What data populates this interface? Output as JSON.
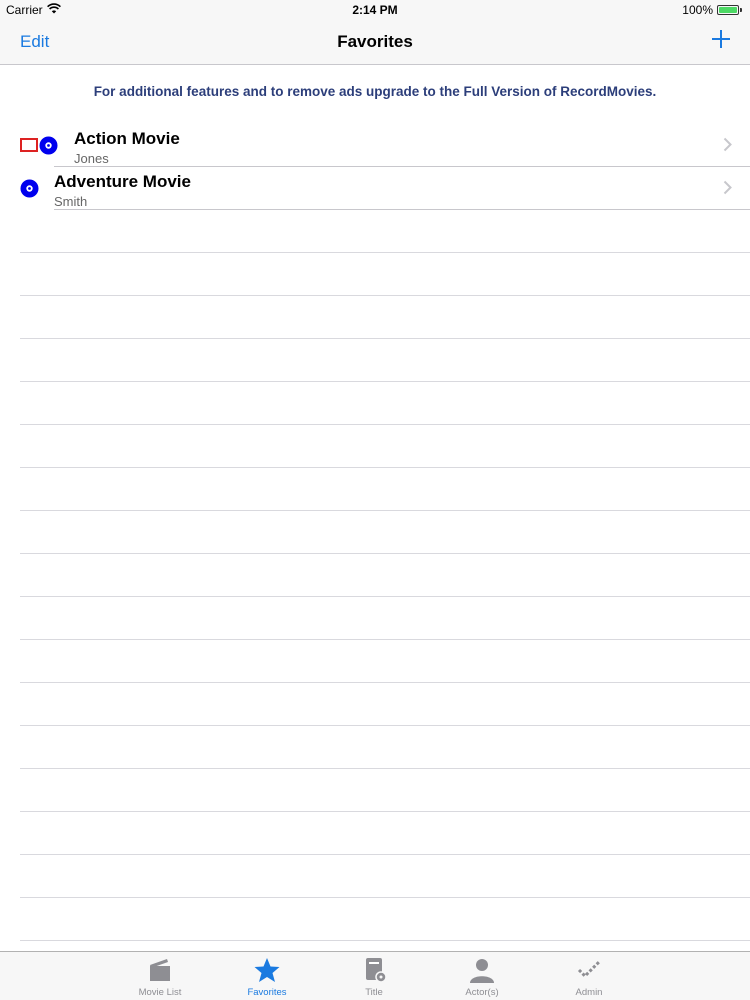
{
  "status_bar": {
    "carrier": "Carrier",
    "time": "2:14 PM",
    "battery": "100%"
  },
  "nav": {
    "edit_label": "Edit",
    "title": "Favorites",
    "add_icon": "plus-icon"
  },
  "banner": {
    "text": "For additional features and to remove ads upgrade to the Full Version of RecordMovies."
  },
  "rows": [
    {
      "title": "Action Movie",
      "subtitle": "Jones",
      "icons": [
        "tape-icon",
        "disc-icon"
      ]
    },
    {
      "title": "Adventure Movie",
      "subtitle": "Smith",
      "icons": [
        "disc-icon"
      ]
    }
  ],
  "tabs": [
    {
      "label": "Movie List",
      "icon": "clapperboard-icon",
      "active": false
    },
    {
      "label": "Favorites",
      "icon": "star-icon",
      "active": true
    },
    {
      "label": "Title",
      "icon": "book-icon",
      "active": false
    },
    {
      "label": "Actor(s)",
      "icon": "person-icon",
      "active": false
    },
    {
      "label": "Admin",
      "icon": "checkmark-icon",
      "active": false
    }
  ],
  "colors": {
    "accent": "#1a7ae0",
    "banner_text": "#2c3e7a",
    "disc": "#0000ee",
    "tape": "#dd2222",
    "inactive_tab": "#8e8e93"
  }
}
